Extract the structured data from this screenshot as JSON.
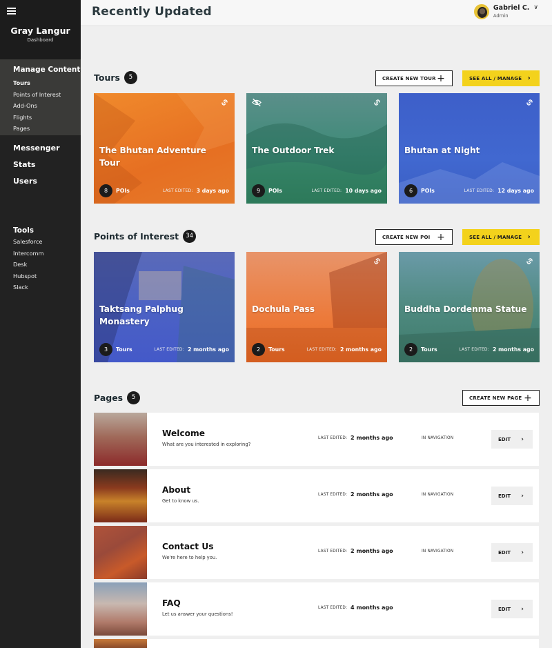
{
  "header": {
    "title": "Recently Updated"
  },
  "user": {
    "name": "Gabriel C.",
    "role": "Admin"
  },
  "sidebar": {
    "brand": "Gray Langur",
    "brand_sub": "Dashboard",
    "manage": {
      "heading": "Manage Content",
      "items": [
        "Tours",
        "Points of Interest",
        "Add-Ons",
        "Flights",
        "Pages"
      ]
    },
    "main_items": [
      "Messenger",
      "Stats",
      "Users"
    ],
    "tools": {
      "heading": "Tools",
      "items": [
        "Salesforce",
        "Intercomm",
        "Desk",
        "Hubspot",
        "Slack"
      ]
    }
  },
  "tours": {
    "title": "Tours",
    "count": "5",
    "create_label": "CREATE NEW TOUR",
    "see_all_label": "SEE ALL / MANAGE",
    "cards": [
      {
        "title": "The Bhutan Adventure Tour",
        "num": "8",
        "unit": "POIs",
        "last_edited_label": "LAST EDITED:",
        "when": "3 days ago"
      },
      {
        "title": "The Outdoor Trek",
        "num": "9",
        "unit": "POIs",
        "last_edited_label": "LAST EDITED:",
        "when": "10 days ago"
      },
      {
        "title": "Bhutan at Night",
        "num": "6",
        "unit": "POIs",
        "last_edited_label": "LAST EDITED:",
        "when": "12 days ago"
      }
    ]
  },
  "poi": {
    "title": "Points of Interest",
    "count": "34",
    "create_label": "CREATE NEW POI",
    "see_all_label": "SEE ALL / MANAGE",
    "cards": [
      {
        "title": "Taktsang Palphug Monastery",
        "num": "3",
        "unit": "Tours",
        "last_edited_label": "LAST EDITED:",
        "when": "2 months ago"
      },
      {
        "title": "Dochula Pass",
        "num": "2",
        "unit": "Tours",
        "last_edited_label": "LAST EDITED:",
        "when": "2 months ago"
      },
      {
        "title": "Buddha Dordenma Statue",
        "num": "2",
        "unit": "Tours",
        "last_edited_label": "LAST EDITED:",
        "when": "2 months ago"
      }
    ]
  },
  "pages": {
    "title": "Pages",
    "count": "5",
    "create_label": "CREATE NEW PAGE",
    "rows": [
      {
        "title": "Welcome",
        "subtitle": "What are you interested in exploring?",
        "last_edited_label": "LAST EDITED:",
        "when": "2 months ago",
        "nav": "IN NAVIGATION",
        "edit": "EDIT"
      },
      {
        "title": "About",
        "subtitle": "Get to know us.",
        "last_edited_label": "LAST EDITED:",
        "when": "2 months ago",
        "nav": "IN NAVIGATION",
        "edit": "EDIT"
      },
      {
        "title": "Contact Us",
        "subtitle": "We're here to help you.",
        "last_edited_label": "LAST EDITED:",
        "when": "2 months ago",
        "nav": "IN NAVIGATION",
        "edit": "EDIT"
      },
      {
        "title": "FAQ",
        "subtitle": "Let us answer your questions!",
        "last_edited_label": "LAST EDITED:",
        "when": "4 months ago",
        "nav": "",
        "edit": "EDIT"
      }
    ]
  },
  "colors": {
    "accent_yellow": "#f3d21c",
    "sidebar_bg": "#222222",
    "tour_orange": "#e97a28",
    "tour_teal": "#3c8a7a",
    "tour_blue": "#3e60c9"
  }
}
